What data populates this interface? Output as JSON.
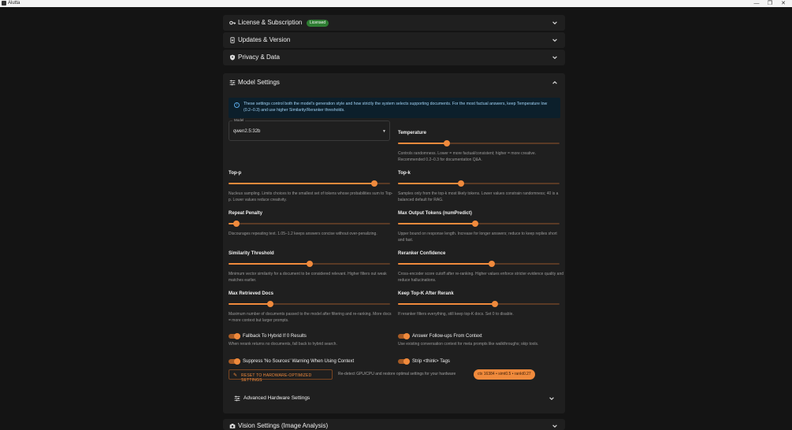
{
  "window": {
    "title": "Alutta",
    "minimize": "—",
    "maximize": "❐",
    "close": "✕"
  },
  "sections": {
    "license": {
      "title": "License & Subscription",
      "badge": "Licensed"
    },
    "updates": {
      "title": "Updates & Version"
    },
    "privacy": {
      "title": "Privacy & Data"
    },
    "vision": {
      "title": "Vision Settings (Image Analysis)"
    }
  },
  "model_settings": {
    "title": "Model Settings",
    "info": "These settings control both the model's generation style and how strictly the system selects supporting documents. For the most factual answers, keep Temperature low (0.2–0.3) and use higher Similarity/Reranker thresholds.",
    "model_field": {
      "label": "Model",
      "value": "qwen2.5:32b"
    },
    "sliders": [
      {
        "label": "Temperature",
        "help": "Controls randomness. Lower = more factual/consistent; higher = more creative. Recommended 0.2–0.3 for documentation Q&A.",
        "level": 0.3
      },
      {
        "label": "Top-p",
        "help": "Nucleus sampling. Limits choices to the smallest set of tokens whose probabilities sum to Top-p. Lower values reduce creativity.",
        "level": 0.9
      },
      {
        "label": "Top-k",
        "help": "Samples only from the top-k most likely tokens. Lower values constrain randomness; 40 is a balanced default for RAG.",
        "level": 0.39
      },
      {
        "label": "Repeat Penalty",
        "help": "Discourages repeating text. 1.05–1.2 keeps answers concise without over-penalizing.",
        "level": 0.05
      },
      {
        "label": "Max Output Tokens (numPredict)",
        "help": "Upper bound on response length. Increase for longer answers; reduce to keep replies short and fast.",
        "level": 0.48
      },
      {
        "label": "Similarity Threshold",
        "help": "Minimum vector similarity for a document to be considered relevant. Higher filters out weak matches earlier.",
        "level": 0.5
      },
      {
        "label": "Reranker Confidence",
        "help": "Cross-encoder score cutoff after re-ranking. Higher values enforce stricter evidence quality and reduce hallucinations.",
        "level": 0.58
      },
      {
        "label": "Max Retrieved Docs",
        "help": "Maximum number of documents passed to the model after filtering and re-ranking. More docs = more context but larger prompts.",
        "level": 0.26
      },
      {
        "label": "Keep Top-K After Rerank",
        "help": "If reranker filters everything, still keep top-K docs. Set 0 to disable.",
        "level": 0.6
      }
    ],
    "toggles": [
      {
        "label": "Fallback To Hybrid If 0 Results",
        "help": "When rerank returns no documents, fall back to hybrid search.",
        "on": true
      },
      {
        "label": "Answer Follow-ups From Context",
        "help": "Use existing conversation context for meta prompts like walkthroughs; skip tools.",
        "on": true
      },
      {
        "label": "Suppress 'No Sources' Warning When Using Context",
        "help": "",
        "on": true
      },
      {
        "label": "Strip <think> Tags",
        "help": "",
        "on": true
      }
    ],
    "reset": {
      "label": "RESET TO HARDWARE-OPTIMIZED SETTINGS",
      "description": "Re-detect GPU/CPU and restore optimal settings for your hardware",
      "chip": "ctx 16384 • simt0.5 • rankt0.27"
    },
    "advanced": {
      "title": "Advanced Hardware Settings"
    }
  },
  "colors": {
    "accent": "#f08a3c",
    "badge": "#2e7d32",
    "info_bg": "#0c1f2b",
    "info_text": "#9fd2f5"
  },
  "icons": [
    "key-icon",
    "phone-update-icon",
    "shield-icon",
    "tune-icon",
    "info-icon",
    "wrench-icon",
    "camera-icon",
    "chevron-down-icon",
    "chevron-up-icon"
  ]
}
